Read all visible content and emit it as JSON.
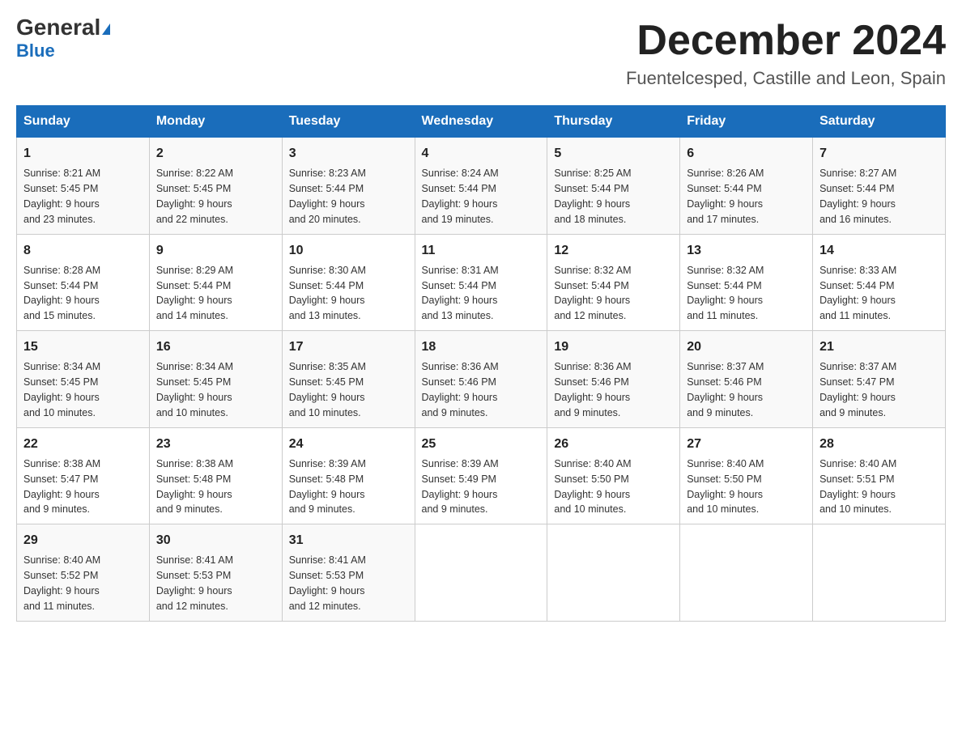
{
  "header": {
    "logo_main": "General",
    "logo_sub": "Blue",
    "month_title": "December 2024",
    "location": "Fuentelcesped, Castille and Leon, Spain"
  },
  "days_of_week": [
    "Sunday",
    "Monday",
    "Tuesday",
    "Wednesday",
    "Thursday",
    "Friday",
    "Saturday"
  ],
  "weeks": [
    [
      {
        "day": "1",
        "sunrise": "8:21 AM",
        "sunset": "5:45 PM",
        "daylight": "9 hours and 23 minutes."
      },
      {
        "day": "2",
        "sunrise": "8:22 AM",
        "sunset": "5:45 PM",
        "daylight": "9 hours and 22 minutes."
      },
      {
        "day": "3",
        "sunrise": "8:23 AM",
        "sunset": "5:44 PM",
        "daylight": "9 hours and 20 minutes."
      },
      {
        "day": "4",
        "sunrise": "8:24 AM",
        "sunset": "5:44 PM",
        "daylight": "9 hours and 19 minutes."
      },
      {
        "day": "5",
        "sunrise": "8:25 AM",
        "sunset": "5:44 PM",
        "daylight": "9 hours and 18 minutes."
      },
      {
        "day": "6",
        "sunrise": "8:26 AM",
        "sunset": "5:44 PM",
        "daylight": "9 hours and 17 minutes."
      },
      {
        "day": "7",
        "sunrise": "8:27 AM",
        "sunset": "5:44 PM",
        "daylight": "9 hours and 16 minutes."
      }
    ],
    [
      {
        "day": "8",
        "sunrise": "8:28 AM",
        "sunset": "5:44 PM",
        "daylight": "9 hours and 15 minutes."
      },
      {
        "day": "9",
        "sunrise": "8:29 AM",
        "sunset": "5:44 PM",
        "daylight": "9 hours and 14 minutes."
      },
      {
        "day": "10",
        "sunrise": "8:30 AM",
        "sunset": "5:44 PM",
        "daylight": "9 hours and 13 minutes."
      },
      {
        "day": "11",
        "sunrise": "8:31 AM",
        "sunset": "5:44 PM",
        "daylight": "9 hours and 13 minutes."
      },
      {
        "day": "12",
        "sunrise": "8:32 AM",
        "sunset": "5:44 PM",
        "daylight": "9 hours and 12 minutes."
      },
      {
        "day": "13",
        "sunrise": "8:32 AM",
        "sunset": "5:44 PM",
        "daylight": "9 hours and 11 minutes."
      },
      {
        "day": "14",
        "sunrise": "8:33 AM",
        "sunset": "5:44 PM",
        "daylight": "9 hours and 11 minutes."
      }
    ],
    [
      {
        "day": "15",
        "sunrise": "8:34 AM",
        "sunset": "5:45 PM",
        "daylight": "9 hours and 10 minutes."
      },
      {
        "day": "16",
        "sunrise": "8:34 AM",
        "sunset": "5:45 PM",
        "daylight": "9 hours and 10 minutes."
      },
      {
        "day": "17",
        "sunrise": "8:35 AM",
        "sunset": "5:45 PM",
        "daylight": "9 hours and 10 minutes."
      },
      {
        "day": "18",
        "sunrise": "8:36 AM",
        "sunset": "5:46 PM",
        "daylight": "9 hours and 9 minutes."
      },
      {
        "day": "19",
        "sunrise": "8:36 AM",
        "sunset": "5:46 PM",
        "daylight": "9 hours and 9 minutes."
      },
      {
        "day": "20",
        "sunrise": "8:37 AM",
        "sunset": "5:46 PM",
        "daylight": "9 hours and 9 minutes."
      },
      {
        "day": "21",
        "sunrise": "8:37 AM",
        "sunset": "5:47 PM",
        "daylight": "9 hours and 9 minutes."
      }
    ],
    [
      {
        "day": "22",
        "sunrise": "8:38 AM",
        "sunset": "5:47 PM",
        "daylight": "9 hours and 9 minutes."
      },
      {
        "day": "23",
        "sunrise": "8:38 AM",
        "sunset": "5:48 PM",
        "daylight": "9 hours and 9 minutes."
      },
      {
        "day": "24",
        "sunrise": "8:39 AM",
        "sunset": "5:48 PM",
        "daylight": "9 hours and 9 minutes."
      },
      {
        "day": "25",
        "sunrise": "8:39 AM",
        "sunset": "5:49 PM",
        "daylight": "9 hours and 9 minutes."
      },
      {
        "day": "26",
        "sunrise": "8:40 AM",
        "sunset": "5:50 PM",
        "daylight": "9 hours and 10 minutes."
      },
      {
        "day": "27",
        "sunrise": "8:40 AM",
        "sunset": "5:50 PM",
        "daylight": "9 hours and 10 minutes."
      },
      {
        "day": "28",
        "sunrise": "8:40 AM",
        "sunset": "5:51 PM",
        "daylight": "9 hours and 10 minutes."
      }
    ],
    [
      {
        "day": "29",
        "sunrise": "8:40 AM",
        "sunset": "5:52 PM",
        "daylight": "9 hours and 11 minutes."
      },
      {
        "day": "30",
        "sunrise": "8:41 AM",
        "sunset": "5:53 PM",
        "daylight": "9 hours and 12 minutes."
      },
      {
        "day": "31",
        "sunrise": "8:41 AM",
        "sunset": "5:53 PM",
        "daylight": "9 hours and 12 minutes."
      },
      null,
      null,
      null,
      null
    ]
  ],
  "labels": {
    "sunrise": "Sunrise:",
    "sunset": "Sunset:",
    "daylight": "Daylight:"
  }
}
